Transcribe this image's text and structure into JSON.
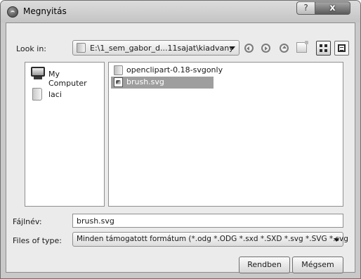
{
  "window": {
    "title": "Megnyitás",
    "help_glyph": "?",
    "close_glyph": "x"
  },
  "toolbar": {
    "look_in_label": "Look in:",
    "path": "E:\\1_sem_gabor_d...11sajat\\kiadvany",
    "icons": [
      "back-icon",
      "forward-icon",
      "up-icon",
      "new-folder-icon",
      "detail-view-icon",
      "list-view-icon"
    ]
  },
  "sidebar": {
    "items": [
      {
        "label": "My Computer",
        "icon": "computer-icon"
      },
      {
        "label": "laci",
        "icon": "user-folder-icon"
      }
    ]
  },
  "files": [
    {
      "name": "openclipart-0.18-svgonly",
      "type": "folder",
      "selected": false
    },
    {
      "name": "brush.svg",
      "type": "svg-file",
      "selected": true
    }
  ],
  "form": {
    "filename_label": "Fájlnév:",
    "filename_value": "brush.svg",
    "filetype_label": "Files of type:",
    "filetype_value": "Minden támogatott formátum (*.odg *.ODG *.sxd *.SXD *.svg *.SVG *.svg"
  },
  "buttons": {
    "ok_label": "Rendben",
    "cancel_label": "Mégsem"
  },
  "colors": {
    "selection": "#9e9e9e",
    "client_bg": "#ebebeb"
  }
}
